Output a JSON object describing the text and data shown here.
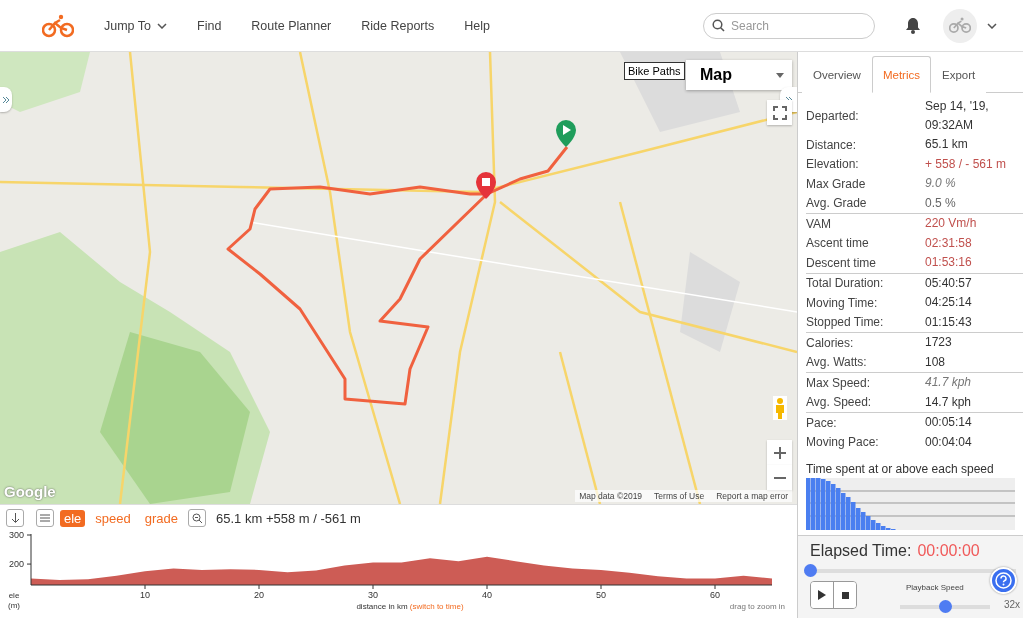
{
  "nav": {
    "items": [
      {
        "label": "Jump To",
        "kind": "dropdown"
      },
      {
        "label": "Find",
        "kind": "link"
      },
      {
        "label": "Route Planner",
        "kind": "link"
      },
      {
        "label": "Ride Reports",
        "kind": "link"
      },
      {
        "label": "Help",
        "kind": "link"
      }
    ],
    "search": {
      "placeholder": "Search"
    }
  },
  "map": {
    "layers_button": "Bike Paths",
    "type_select": "Map",
    "logo": "Google",
    "attribution": [
      "Map data ©2019",
      "Terms of Use",
      "Report a map error"
    ]
  },
  "elevation": {
    "modes": [
      {
        "label": "ele",
        "selected": true
      },
      {
        "label": "speed",
        "selected": false
      },
      {
        "label": "grade",
        "selected": false
      }
    ],
    "summary": "65.1 km +558 m / -561 m",
    "chart_data": {
      "type": "area",
      "xlabel": "distance in km",
      "x": [
        0,
        2.5,
        5,
        7.5,
        10,
        12.5,
        15,
        17.5,
        20,
        22.5,
        25,
        27.5,
        30,
        32.5,
        35,
        37.5,
        40,
        42.5,
        45,
        47.5,
        50,
        52.5,
        55,
        57.5,
        60,
        62.5,
        65
      ],
      "series": [
        {
          "color": "#cd5c55",
          "values": [
            150,
            145,
            148,
            160,
            175,
            185,
            180,
            182,
            180,
            172,
            178,
            195,
            205,
            205,
            220,
            210,
            225,
            210,
            195,
            185,
            180,
            170,
            158,
            150,
            150,
            160,
            150
          ]
        }
      ],
      "xlim": [
        0,
        65
      ],
      "ylim": [
        128,
        300
      ],
      "xticks": [
        10,
        20,
        30,
        40,
        50,
        60
      ],
      "yticks": [
        200,
        300
      ]
    },
    "ylabel_lines": [
      "ele",
      "(m)"
    ],
    "switch_link": "(switch to time)",
    "hint": "drag to zoom in"
  },
  "sidebar": {
    "tabs": [
      {
        "label": "Overview",
        "selected": false
      },
      {
        "label": "Metrics",
        "selected": true
      },
      {
        "label": "Export",
        "selected": false
      }
    ],
    "metric_groups": [
      {
        "rows": [
          {
            "label": "Departed:",
            "value": "Sep 14, '19, 09:32AM",
            "kind": "plain"
          },
          {
            "label": "Distance:",
            "value": "65.1 km",
            "kind": "plain"
          },
          {
            "label": "Elevation:",
            "value": "+ 558 / - 561 m",
            "kind": "accent"
          },
          {
            "label": "Max Grade",
            "value": "9.0 %",
            "kind": "emphasis"
          },
          {
            "label": "Avg. Grade",
            "value": "0.5 %",
            "kind": "muted"
          }
        ]
      },
      {
        "rows": [
          {
            "label": "VAM",
            "value": "220 Vm/h",
            "kind": "accent"
          },
          {
            "label": "Ascent time",
            "value": "02:31:58",
            "kind": "accent"
          },
          {
            "label": "Descent time",
            "value": "01:53:16",
            "kind": "accent"
          }
        ]
      },
      {
        "rows": [
          {
            "label": "Total Duration:",
            "value": "05:40:57",
            "kind": "plain"
          },
          {
            "label": "Moving Time:",
            "value": "04:25:14",
            "kind": "plain"
          },
          {
            "label": "Stopped Time:",
            "value": "01:15:43",
            "kind": "plain"
          }
        ]
      },
      {
        "rows": [
          {
            "label": "Calories:",
            "value": "1723",
            "kind": "plain"
          },
          {
            "label": "Avg. Watts:",
            "value": "108",
            "kind": "plain"
          }
        ]
      },
      {
        "rows": [
          {
            "label": "Max Speed:",
            "value": "41.7 kph",
            "kind": "emphasis"
          },
          {
            "label": "Avg. Speed:",
            "value": "14.7 kph",
            "kind": "plain"
          }
        ]
      },
      {
        "rows": [
          {
            "label": "Pace:",
            "value": "00:05:14",
            "kind": "plain"
          },
          {
            "label": "Moving Pace:",
            "value": "00:04:04",
            "kind": "plain"
          }
        ]
      }
    ],
    "histogram_title": "Time spent at or above each speed"
  },
  "playback": {
    "label": "Elapsed Time:",
    "time": "00:00:00",
    "timeline": {
      "level": 0
    },
    "speed_label": "Playback Speed",
    "speed": {
      "level": 0.5
    },
    "speed_value": "32x"
  }
}
